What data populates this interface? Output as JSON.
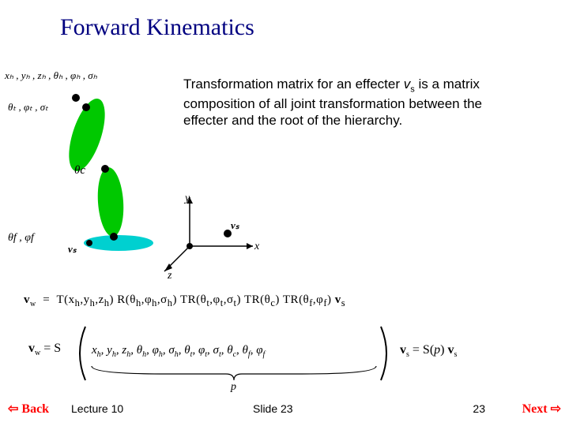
{
  "title": "Forward Kinematics",
  "paragraph": {
    "pre": "Transformation matrix for an effecter ",
    "vs": "v",
    "vs_sub": "s",
    "post": " is a matrix composition of all joint transformation between the effecter and the root of the hierarchy."
  },
  "labels": {
    "hip": "xₕ , yₕ , zₕ , θₕ , φₕ , σₕ",
    "thigh": "θₜ , φₜ , σₜ",
    "calf": "θc",
    "foot": "θf , φf",
    "vs_left": "vₛ",
    "axes": {
      "x": "x",
      "y": "y",
      "z": "z",
      "vs": "vₛ"
    }
  },
  "eq1": "v_w = T(xₕ,yₕ,zₕ) R(θₕ,φₕ,σₕ) TR(θₜ,φₜ,σₜ) TR(θc) TR(θf,φf) v_s",
  "eq2": {
    "left": "v_w = S",
    "params": "xₕ , yₕ , zₕ , θₕ , φₕ , σₕ , θₜ , φₜ , σₜ , θc , θf , φf",
    "p": "p",
    "right": "v_s = S(p) v_s"
  },
  "footer": {
    "back": "Back",
    "next": "Next",
    "lecture": "Lecture 10",
    "slide": "Slide 23",
    "page": "23"
  },
  "colors": {
    "title": "#000080",
    "limb": "#00e000",
    "foot": "#00d0d0",
    "accent": "#ff0000"
  }
}
